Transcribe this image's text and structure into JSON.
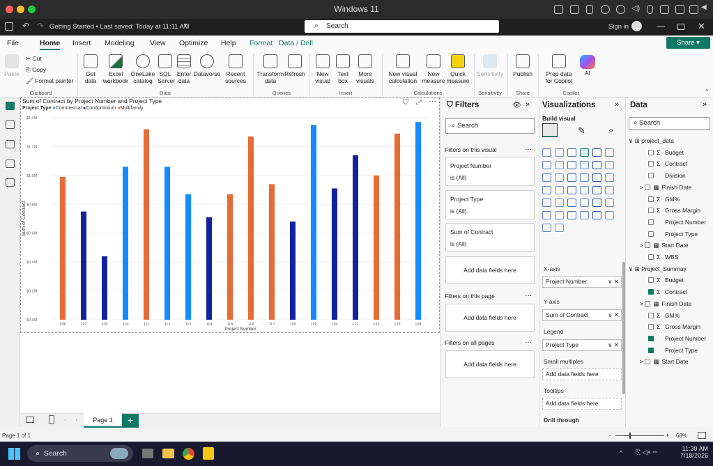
{
  "mac": {
    "title": "Windows 11"
  },
  "app": {
    "file_status": "Getting Started • Last saved: Today at 11:11 AM",
    "search_placeholder": "Search",
    "signin": "Sign in"
  },
  "menu": {
    "items": [
      "File",
      "Home",
      "Insert",
      "Modeling",
      "View",
      "Optimize",
      "Help",
      "Format",
      "Data / Drill"
    ],
    "share": "Share"
  },
  "ribbon": {
    "clipboard": {
      "paste": "Paste",
      "cut": "Cut",
      "copy": "Copy",
      "format_painter": "Format painter",
      "group": "Clipboard"
    },
    "data": {
      "items": [
        "Get data",
        "Excel workbook",
        "OneLake catalog",
        "SQL Server",
        "Enter data",
        "Dataverse",
        "Recent sources"
      ],
      "group": "Data"
    },
    "queries": {
      "items": [
        "Transform data",
        "Refresh"
      ],
      "group": "Queries"
    },
    "insert": {
      "items": [
        "New visual",
        "Text box",
        "More visuals"
      ],
      "group": "Insert"
    },
    "calculations": {
      "items": [
        "New visual calculation",
        "New measure",
        "Quick measure"
      ],
      "group": "Calculations"
    },
    "sensitivity": {
      "items": [
        "Sensitivity"
      ],
      "group": "Sensitivity"
    },
    "share": {
      "items": [
        "Publish"
      ],
      "group": "Share"
    },
    "copilot": {
      "items": [
        "Prep data for Copilot",
        "AI"
      ],
      "group": "Copilot"
    }
  },
  "chart_data": {
    "type": "bar",
    "title": "Sum of Contract by Project Number and Project Type",
    "legend_title": "Project Type",
    "legend": [
      {
        "name": "Commercial",
        "color": "#118dff"
      },
      {
        "name": "Condominium",
        "color": "#12239e"
      },
      {
        "name": "Multifamily",
        "color": "#e66c37"
      }
    ],
    "xlabel": "Project Number",
    "ylabel": "Sum of Contract",
    "yticks": [
      "$0.0M",
      "$0.2M",
      "$0.4M",
      "$0.6M",
      "$0.8M",
      "$1.0M",
      "$1.2M",
      "$1.4M"
    ],
    "ylim": [
      0,
      1.4
    ],
    "categories": [
      "106",
      "107",
      "109",
      "110",
      "111",
      "112",
      "113",
      "114",
      "115",
      "116",
      "117",
      "118",
      "119",
      "120",
      "121",
      "122",
      "123",
      "124"
    ],
    "series": [
      {
        "name": "Commercial",
        "values": [
          null,
          null,
          null,
          1.06,
          null,
          1.06,
          0.87,
          null,
          null,
          null,
          null,
          null,
          1.35,
          null,
          null,
          null,
          null,
          1.37
        ]
      },
      {
        "name": "Condominium",
        "values": [
          null,
          0.75,
          0.44,
          null,
          null,
          null,
          null,
          0.71,
          null,
          null,
          null,
          0.68,
          null,
          0.91,
          1.14,
          null,
          null,
          null
        ]
      },
      {
        "name": "Multifamily",
        "values": [
          0.99,
          null,
          null,
          null,
          1.32,
          null,
          null,
          null,
          0.87,
          1.27,
          0.94,
          null,
          null,
          null,
          null,
          1.0,
          1.29,
          null
        ]
      }
    ]
  },
  "filters": {
    "title": "Filters",
    "search": "Search",
    "on_visual": "Filters on this visual",
    "cards": [
      {
        "field": "Project Number",
        "value": "is (All)"
      },
      {
        "field": "Project Type",
        "value": "is (All)"
      },
      {
        "field": "Sum of Contract",
        "value": "is (All)"
      }
    ],
    "add": "Add data fields here",
    "on_page": "Filters on this page",
    "on_all": "Filters on all pages"
  },
  "viz": {
    "title": "Visualizations",
    "build": "Build visual",
    "xaxis_label": "X-axis",
    "xaxis_value": "Project Number",
    "yaxis_label": "Y-axis",
    "yaxis_value": "Sum of Contract",
    "legend_label": "Legend",
    "legend_value": "Project Type",
    "small_multiples": "Small multiples",
    "tooltips": "Tooltips",
    "drill": "Drill through",
    "add": "Add data fields here"
  },
  "data": {
    "title": "Data",
    "search": "Search",
    "tables": [
      {
        "name": "project_data",
        "fields": [
          {
            "name": "Budget",
            "sigma": true,
            "checked": false
          },
          {
            "name": "Contract",
            "sigma": true,
            "checked": false
          },
          {
            "name": "Division",
            "sigma": false,
            "checked": false
          },
          {
            "name": "Finish Date",
            "sigma": false,
            "checked": false,
            "date": true
          },
          {
            "name": "GM%",
            "sigma": true,
            "checked": false
          },
          {
            "name": "Gross Margin",
            "sigma": true,
            "checked": false
          },
          {
            "name": "Project Number",
            "sigma": false,
            "checked": false
          },
          {
            "name": "Project Type",
            "sigma": false,
            "checked": false
          },
          {
            "name": "Start Date",
            "sigma": false,
            "checked": false,
            "date": true
          },
          {
            "name": "WBS",
            "sigma": true,
            "checked": false
          }
        ]
      },
      {
        "name": "Project_Summay",
        "fields": [
          {
            "name": "Budget",
            "sigma": true,
            "checked": false
          },
          {
            "name": "Contract",
            "sigma": true,
            "checked": true
          },
          {
            "name": "Finish Date",
            "sigma": false,
            "checked": false,
            "date": true
          },
          {
            "name": "GM%",
            "sigma": true,
            "checked": false
          },
          {
            "name": "Gross Margin",
            "sigma": true,
            "checked": false
          },
          {
            "name": "Project Number",
            "sigma": false,
            "checked": true
          },
          {
            "name": "Project Type",
            "sigma": false,
            "checked": true
          },
          {
            "name": "Start Date",
            "sigma": false,
            "checked": false,
            "date": true
          }
        ]
      }
    ]
  },
  "page": {
    "tab": "Page 1",
    "status": "Page 1 of 1",
    "zoom": "68%"
  },
  "taskbar": {
    "search": "Search",
    "time": "11:39 AM",
    "date": "7/18/2026"
  }
}
